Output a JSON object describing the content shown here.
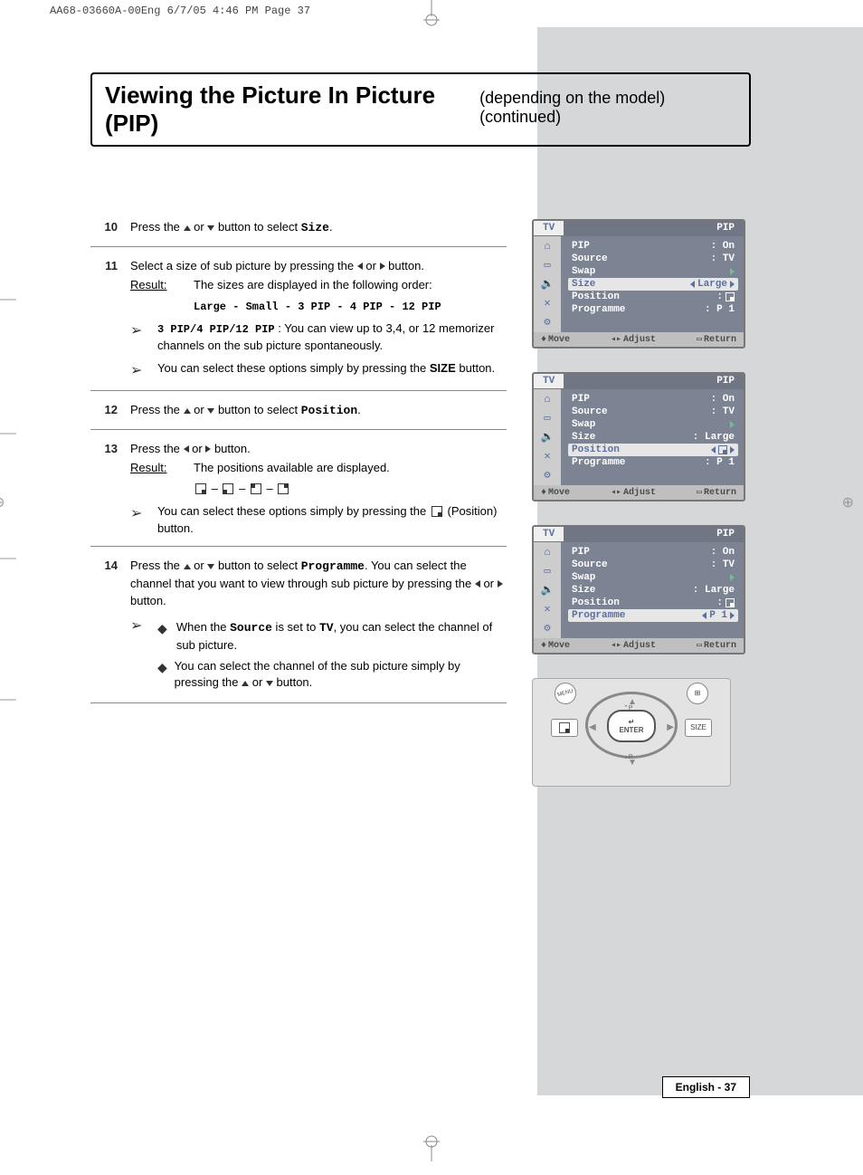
{
  "header_info": "AA68-03660A-00Eng  6/7/05  4:46 PM  Page 37",
  "title_bold": "Viewing the Picture In Picture (PIP)",
  "title_rest": "(depending on the model) (continued)",
  "steps": {
    "s10": {
      "num": "10",
      "text_a": "Press the ",
      "text_b": " or ",
      "text_c": " button to select ",
      "target": "Size",
      "text_d": "."
    },
    "s11": {
      "num": "11",
      "line1_a": "Select a size of sub picture by pressing the ",
      "line1_b": " or ",
      "line1_c": " button.",
      "result_label": "Result:",
      "result_text": "The sizes are displayed in the following order:",
      "order": "Large - Small - 3 PIP - 4 PIP - 12 PIP",
      "note1_label": "3 PIP/4 PIP/12 PIP",
      "note1_text": " : You can view up to 3,4, or 12 memorizer channels on the sub picture spontaneously.",
      "note2_a": "You can select these options simply by pressing the ",
      "note2_b": "SIZE",
      "note2_c": " button."
    },
    "s12": {
      "num": "12",
      "text_a": "Press the ",
      "text_b": " or ",
      "text_c": " button to select ",
      "target": "Position",
      "text_d": "."
    },
    "s13": {
      "num": "13",
      "line1_a": "Press the ",
      "line1_b": " or ",
      "line1_c": " button.",
      "result_label": "Result:",
      "result_text": "The positions available are displayed.",
      "note_a": "You can select these options simply by pressing the ",
      "note_b": "(Position) button."
    },
    "s14": {
      "num": "14",
      "line1_a": "Press the ",
      "line1_b": " or ",
      "line1_c": " button to select ",
      "line1_t": "Programme",
      "line1_d": ". You can select the channel that you want to view through sub picture by pressing the ",
      "line1_e": " or ",
      "line1_f": " button.",
      "b1_a": "When the ",
      "b1_b": "Source",
      "b1_c": " is set to ",
      "b1_d": "TV",
      "b1_e": ", you can select the channel of sub picture.",
      "b2_a": "You can select the channel of the sub picture simply by pressing the ",
      "b2_b": " or ",
      "b2_c": " button."
    }
  },
  "osd_common": {
    "tv": "TV",
    "pip": "PIP",
    "row_pip": "PIP",
    "row_source": "Source",
    "row_swap": "Swap",
    "row_size": "Size",
    "row_position": "Position",
    "row_programme": "Programme",
    "val_on": ": On",
    "val_tv": ": TV",
    "val_large": ": Large",
    "val_large_sel": "Large",
    "val_p1": ": P 1",
    "val_p1_sel": "P 1",
    "foot_move": "Move",
    "foot_adjust": "Adjust",
    "foot_return": "Return"
  },
  "remote": {
    "enter": "ENTER",
    "size": "SIZE",
    "menu": "MENU"
  },
  "page_number": "English - 37"
}
